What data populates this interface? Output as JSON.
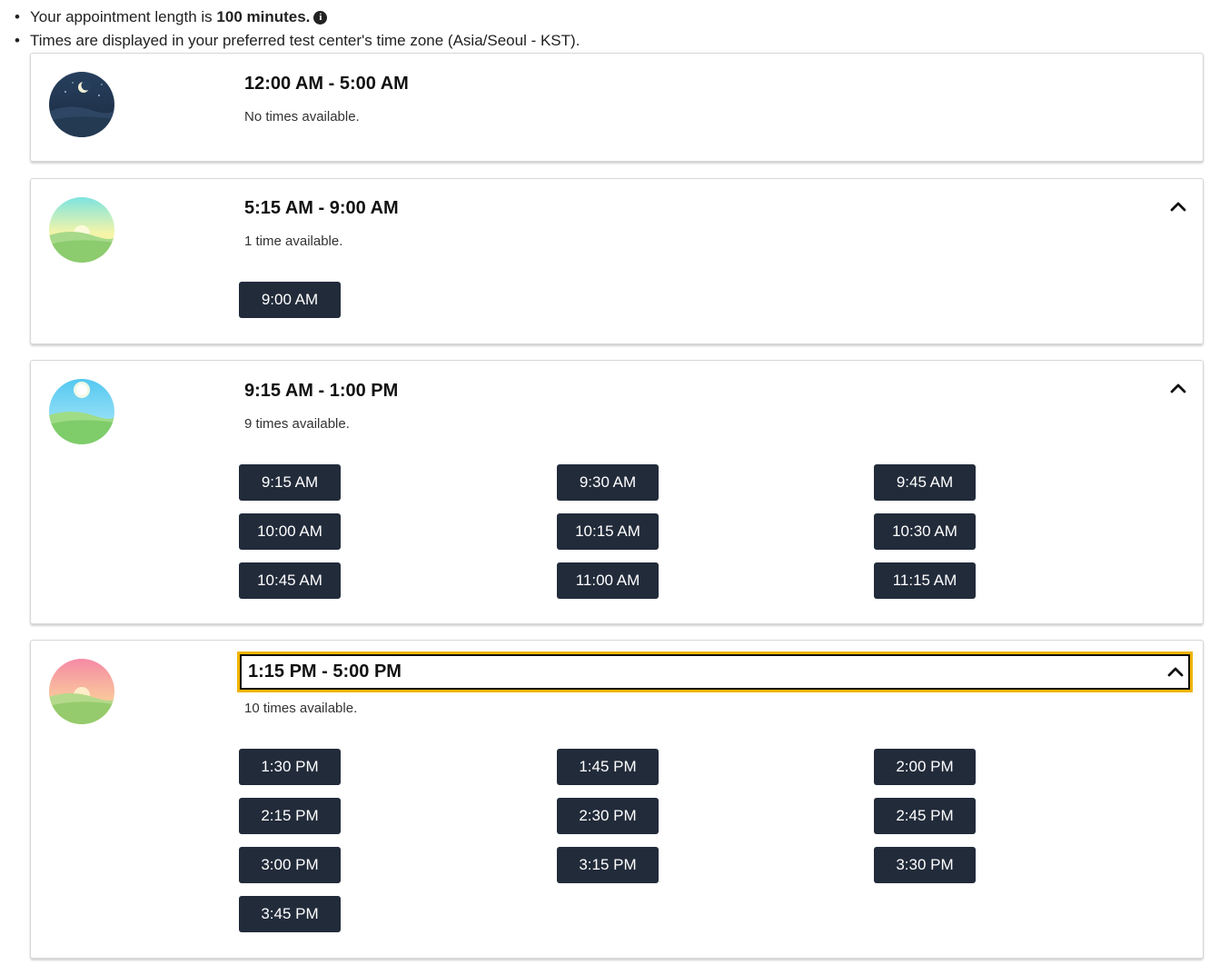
{
  "notes": {
    "length_prefix": "Your appointment length is ",
    "length_value": "100 minutes.",
    "timezone_text": "Times are displayed in your preferred test center's time zone (Asia/Seoul - KST)."
  },
  "ranges": [
    {
      "title": "12:00 AM - 5:00 AM",
      "availability": "No times available.",
      "icon": "night-moon-icon",
      "slots": []
    },
    {
      "title": "5:15 AM - 9:00 AM",
      "availability": "1 time available.",
      "icon": "sunrise-icon",
      "slots": [
        "9:00 AM"
      ]
    },
    {
      "title": "9:15 AM - 1:00 PM",
      "availability": "9 times available.",
      "icon": "midday-sun-icon",
      "slots": [
        "9:15 AM",
        "9:30 AM",
        "9:45 AM",
        "10:00 AM",
        "10:15 AM",
        "10:30 AM",
        "10:45 AM",
        "11:00 AM",
        "11:15 AM"
      ]
    },
    {
      "title": "1:15 PM - 5:00 PM",
      "availability": "10 times available.",
      "icon": "sunset-icon",
      "slots": [
        "1:30 PM",
        "1:45 PM",
        "2:00 PM",
        "2:15 PM",
        "2:30 PM",
        "2:45 PM",
        "3:00 PM",
        "3:15 PM",
        "3:30 PM",
        "3:45 PM"
      ]
    }
  ],
  "colors": {
    "slot_button": "#222b3a",
    "focus_ring": "#f0b400"
  }
}
